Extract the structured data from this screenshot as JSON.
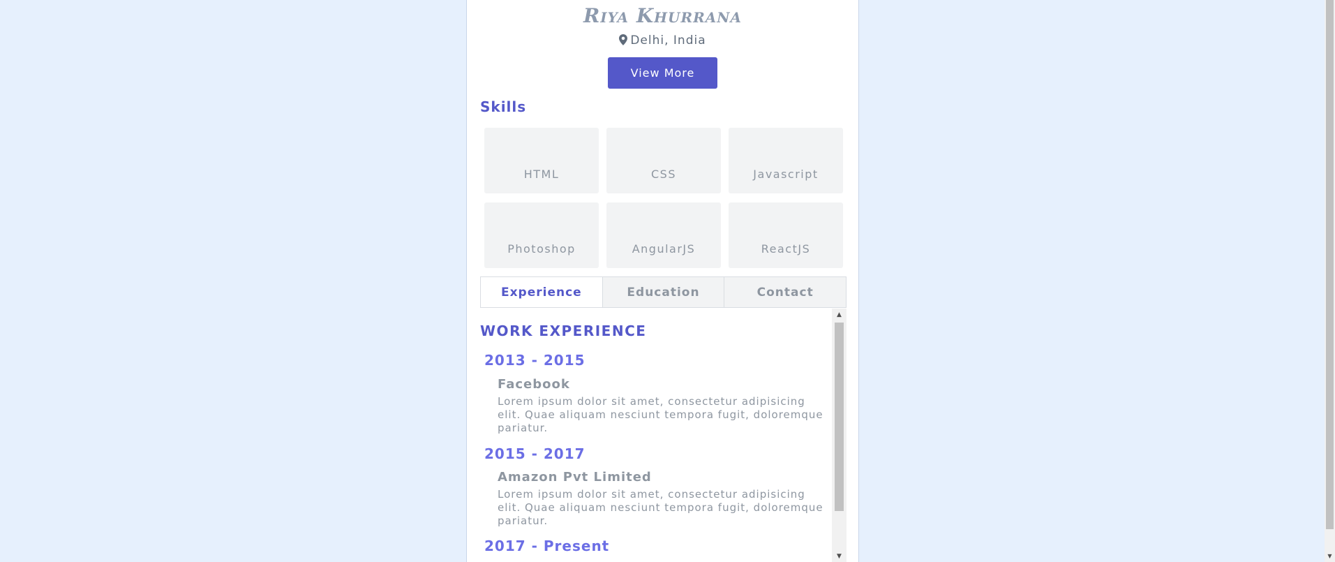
{
  "profile": {
    "name": "Riya Khurrana",
    "location": "Delhi, India",
    "location_icon": "map-marker-icon",
    "view_more_label": "View More"
  },
  "skills": {
    "title": "Skills",
    "items": [
      "HTML",
      "CSS",
      "Javascript",
      "Photoshop",
      "AngularJS",
      "ReactJS"
    ]
  },
  "tabs": [
    {
      "label": "Experience",
      "active": true
    },
    {
      "label": "Education",
      "active": false
    },
    {
      "label": "Contact",
      "active": false
    }
  ],
  "work": {
    "title": "WORK EXPERIENCE",
    "entries": [
      {
        "years": "2013 - 2015",
        "company": "Facebook",
        "description": "Lorem ipsum dolor sit amet, consectetur adipisicing elit. Quae aliquam nesciunt tempora fugit, doloremque pariatur."
      },
      {
        "years": "2015 - 2017",
        "company": "Amazon Pvt Limited",
        "description": "Lorem ipsum dolor sit amet, consectetur adipisicing elit. Quae aliquam nesciunt tempora fugit, doloremque pariatur."
      },
      {
        "years": "2017 - Present",
        "company": "",
        "description": ""
      }
    ]
  },
  "colors": {
    "page_background": "#e6f0fd",
    "accent": "#5458c9",
    "year_accent": "#6b6ee5",
    "muted_text": "#8e96a0"
  }
}
